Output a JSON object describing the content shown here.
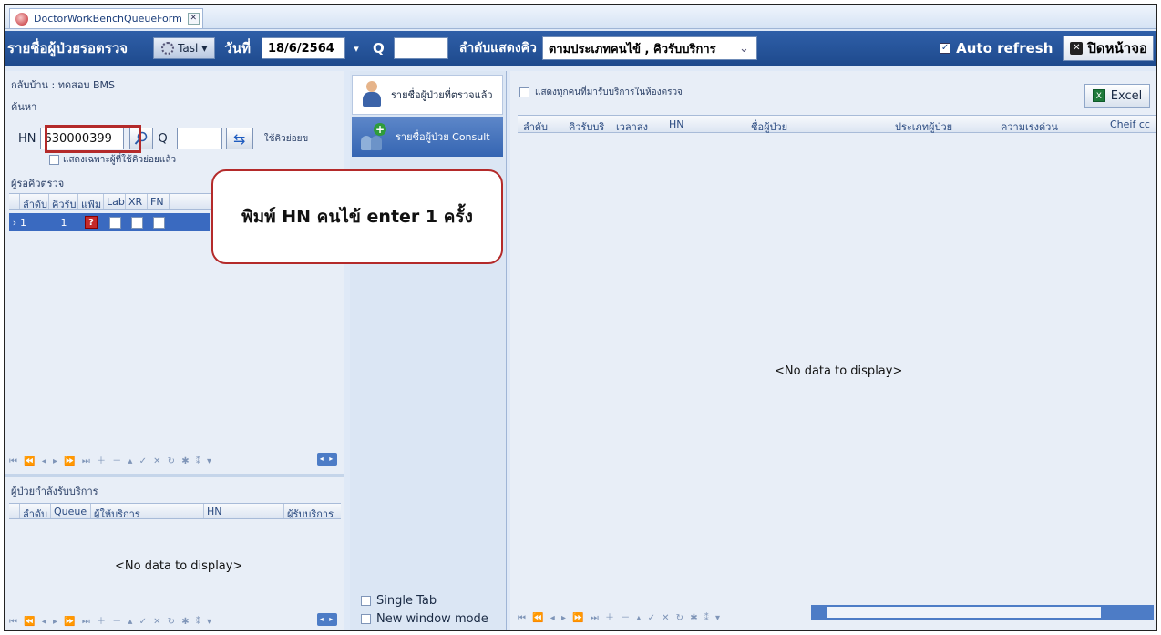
{
  "tab": {
    "title": "DoctorWorkBenchQueueForm",
    "close": "✕"
  },
  "toolbar": {
    "title": "รายชื่อผู้ป่วยรอตรวจ",
    "task_label": "Tasl",
    "date_label": "วันที่",
    "date_value": "18/6/2564",
    "q_label": "Q",
    "q_value": "",
    "order_label": "ลำดับแสดงคิว",
    "order_value": "ตามประเภทคนไข้ , คิวรับบริการ",
    "auto_refresh_label": "Auto refresh",
    "close_label": "ปิดหน้าจอ"
  },
  "left": {
    "home_label": "กลับบ้าน : ทดสอบ BMS",
    "search_label": "ค้นหา",
    "hn_label": "HN",
    "hn_value": "630000399",
    "q_label": "Q",
    "use_label": "ใช้คิวย่อยข",
    "only_sub_label": "แสดงเฉพาะผู้ที่ใช้คิวย่อยแล้ว",
    "waiting_label": "ผู้รอคิวตรวจ",
    "waiting_columns": [
      "ลำดับ",
      "คิวรับ",
      "แฟ้ม",
      "Lab",
      "XR",
      "FN"
    ],
    "waiting_row": {
      "order": "1",
      "queue": "1",
      "file_badge": "?"
    },
    "serving_label": "ผู้ป่วยกำลังรับบริการ",
    "serving_columns": [
      "ลำดับ",
      "Queue",
      "ผู้ให้บริการ",
      "HN",
      "ผู้รับบริการ"
    ],
    "no_data": "<No data to display>"
  },
  "middle": {
    "tab1": "รายชื่อผู้ป่วยที่ตรวจแล้ว",
    "tab2": "รายชื่อผู้ป่วย Consult",
    "single_tab": "Single Tab",
    "new_window": "New window mode"
  },
  "right": {
    "show_all_label": "แสดงทุกคนที่มารับบริการในห้องตรวจ",
    "excel_label": "Excel",
    "columns": [
      "ลำดับ",
      "คิวรับบริ",
      "เวลาส่ง",
      "HN",
      "ชื่อผู้ป่วย",
      "ประเภทผู้ป่วย",
      "ความเร่งด่วน",
      "Cheif cc"
    ],
    "no_data": "<No data to display>"
  },
  "annotation": {
    "text": "พิมพ์ HN คนไข้ enter 1 ครั้ง"
  },
  "colors": {
    "toolbar": "#1e4a8d",
    "selection": "#3a6ac0",
    "highlight": "#b42a2a"
  }
}
